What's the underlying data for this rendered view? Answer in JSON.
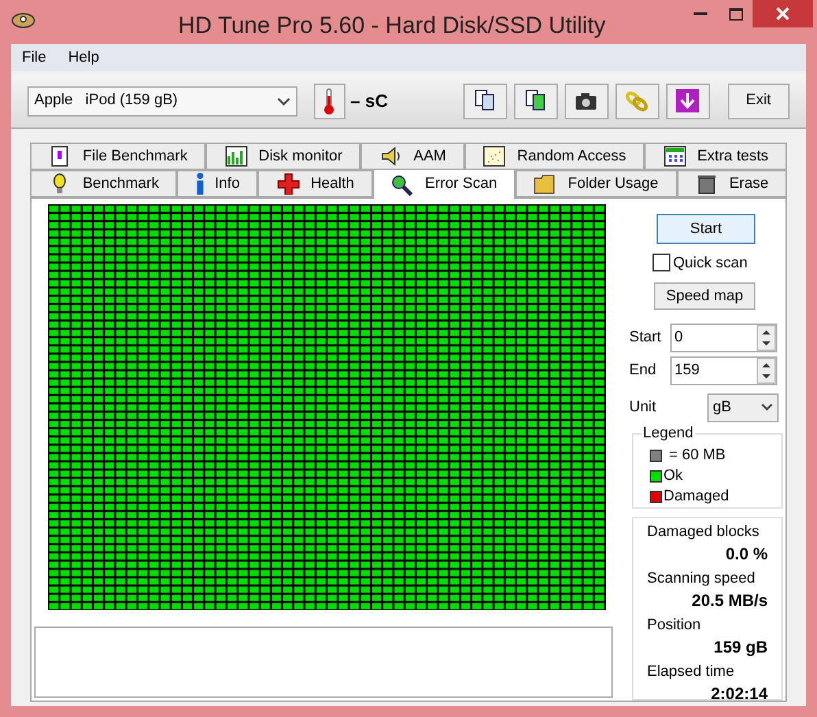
{
  "window": {
    "title": "HD Tune Pro 5.60 - Hard Disk/SSD Utility"
  },
  "menu": [
    {
      "label": "File"
    },
    {
      "label": "Help"
    }
  ],
  "toolbar": {
    "drive": "Apple   iPod (159 gB)",
    "temperature": "– sC",
    "exit": "Exit"
  },
  "tabs_top": [
    {
      "label": "File Benchmark"
    },
    {
      "label": "Disk monitor"
    },
    {
      "label": "AAM"
    },
    {
      "label": "Random Access"
    },
    {
      "label": "Extra tests"
    }
  ],
  "tabs": [
    {
      "label": "Benchmark",
      "selected": false
    },
    {
      "label": "Info",
      "selected": false
    },
    {
      "label": "Health",
      "selected": false
    },
    {
      "label": "Error Scan",
      "selected": true
    },
    {
      "label": "Folder Usage",
      "selected": false
    },
    {
      "label": "Erase",
      "selected": false
    }
  ],
  "controls": {
    "start_button": "Start",
    "quick_scan": {
      "label": "Quick scan",
      "checked": false
    },
    "speed_map_button": "Speed map",
    "start": {
      "label": "Start",
      "value": "0"
    },
    "end": {
      "label": "End",
      "value": "159"
    },
    "unit": {
      "label": "Unit",
      "value": "gB"
    }
  },
  "legend": {
    "title": "Legend",
    "items": [
      {
        "kind": "size",
        "label": "= 60 MB",
        "color": "#808080"
      },
      {
        "kind": "ok",
        "label": "Ok",
        "color": "#00e000"
      },
      {
        "kind": "damaged",
        "label": "Damaged",
        "color": "#e00000"
      }
    ]
  },
  "stats": [
    {
      "label": "Damaged blocks",
      "value": "0.0 %"
    },
    {
      "label": "Scanning speed",
      "value": "20.5 MB/s"
    },
    {
      "label": "Position",
      "value": "159 gB"
    },
    {
      "label": "Elapsed time",
      "value": "2:02:14"
    }
  ]
}
